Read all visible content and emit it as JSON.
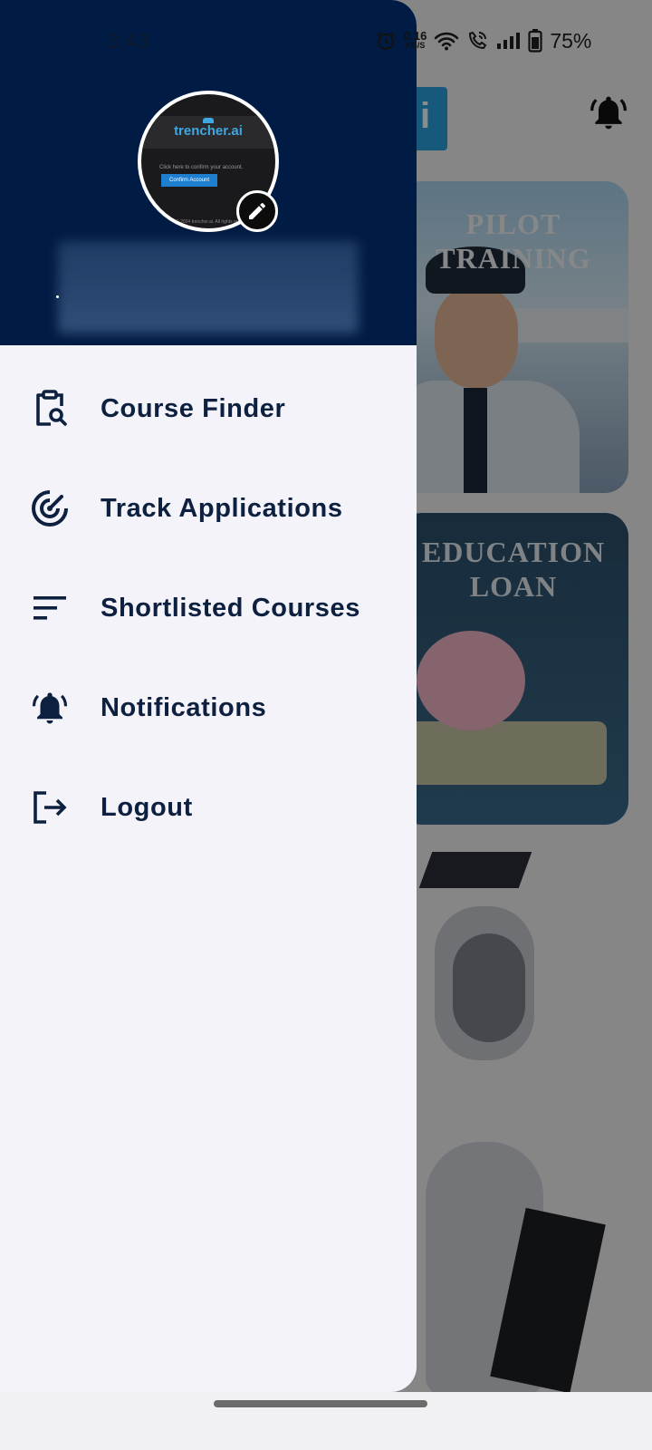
{
  "status_bar": {
    "time": "3:43",
    "net_speed_value": "0.16",
    "net_speed_unit": "KB/S",
    "battery_percent": "75%"
  },
  "drawer": {
    "avatar": {
      "brand": "trencher.ai",
      "text": "Click here to confirm your account.",
      "button": "Confirm Account",
      "footer": "© 2024 trencher.ai. All rights reserved."
    },
    "menu_items": [
      {
        "label": "Course Finder",
        "icon": "clipboard-search-icon"
      },
      {
        "label": "Track Applications",
        "icon": "radar-icon"
      },
      {
        "label": "Shortlisted Courses",
        "icon": "sort-lines-icon"
      },
      {
        "label": "Notifications",
        "icon": "bell-icon"
      },
      {
        "label": "Logout",
        "icon": "logout-icon"
      }
    ]
  },
  "background": {
    "logo_letter": "i",
    "cards": [
      {
        "title": "PILOT TRAINING"
      },
      {
        "title": "EDUCATION LOAN"
      }
    ]
  },
  "colors": {
    "drawer_header": "#001c44",
    "drawer_body": "#f4f3f9",
    "menu_text": "#0d2040"
  }
}
